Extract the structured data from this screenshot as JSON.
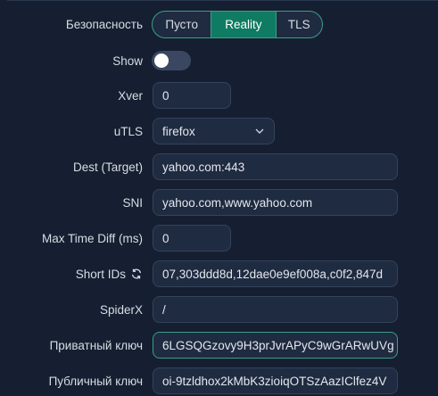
{
  "security": {
    "label": "Безопасность",
    "options": [
      "Пусто",
      "Reality",
      "TLS"
    ],
    "selected": "Reality"
  },
  "show": {
    "label": "Show",
    "enabled": false
  },
  "xver": {
    "label": "Xver",
    "value": "0"
  },
  "utls": {
    "label": "uTLS",
    "value": "firefox"
  },
  "dest": {
    "label": "Dest (Target)",
    "value": "yahoo.com:443"
  },
  "sni": {
    "label": "SNI",
    "value": "yahoo.com,www.yahoo.com"
  },
  "max_time_diff": {
    "label": "Max Time Diff (ms)",
    "value": "0"
  },
  "short_ids": {
    "label": "Short IDs",
    "value": "07,303ddd8d,12dae0e9ef008a,c0f2,847d"
  },
  "spiderx": {
    "label": "SpiderX",
    "value": "/"
  },
  "private_key": {
    "label": "Приватный ключ",
    "value": "6LGSQGzovy9H3prJvrAPyC9wGrARwUVg"
  },
  "public_key": {
    "label": "Публичный ключ",
    "value": "oi-9tzldhox2kMbK3zioiqOTSzAazIClfez4V"
  },
  "colors": {
    "accent": "#0f7b62",
    "accent_border": "#3a9f86",
    "background": "#151f31",
    "field_bg": "#1f2b40"
  },
  "icons": {
    "utls_dropdown": "chevron-down-icon",
    "short_ids_regen": "sync-icon"
  }
}
